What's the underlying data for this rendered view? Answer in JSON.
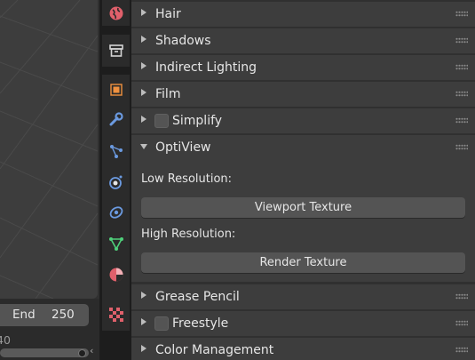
{
  "timeline": {
    "end_label": "End",
    "end_value": "250",
    "frame_fragment": "40",
    "collapse_glyph": "‹"
  },
  "tabs": [
    {
      "name": "world-tab",
      "icon": "world-icon",
      "color": "#e0606b"
    },
    {
      "name": "collection-tab",
      "icon": "collection-icon",
      "color": "#d4d4d4"
    },
    {
      "name": "object-tab",
      "icon": "object-icon",
      "color": "#f0913f"
    },
    {
      "name": "modifier-tab",
      "icon": "wrench-icon",
      "color": "#6b9ae0"
    },
    {
      "name": "particles-tab",
      "icon": "particles-icon",
      "color": "#6b9ae0"
    },
    {
      "name": "physics-tab",
      "icon": "physics-icon",
      "color": "#6b9ae0"
    },
    {
      "name": "constraints-tab",
      "icon": "constraint-icon",
      "color": "#6b9ae0"
    },
    {
      "name": "data-tab",
      "icon": "vertex-data-icon",
      "color": "#4fd07b"
    },
    {
      "name": "material-tab",
      "icon": "material-icon",
      "color": "#e0606b"
    },
    {
      "name": "texture-tab",
      "icon": "texture-checker-icon",
      "color": "#e0606b"
    }
  ],
  "panels": {
    "hair": "Hair",
    "shadows": "Shadows",
    "indirect_lighting": "Indirect Lighting",
    "film": "Film",
    "simplify": "Simplify",
    "optiview": "OptiView",
    "grease_pencil": "Grease Pencil",
    "freestyle": "Freestyle",
    "color_management": "Color Management"
  },
  "optiview": {
    "low_res_label": "Low Resolution:",
    "viewport_texture_button": "Viewport Texture",
    "high_res_label": "High Resolution:",
    "render_texture_button": "Render Texture"
  },
  "colors": {
    "panel_header": "#3d3d3d",
    "background": "#303030",
    "button": "#545454",
    "text": "#e6e6e6"
  }
}
